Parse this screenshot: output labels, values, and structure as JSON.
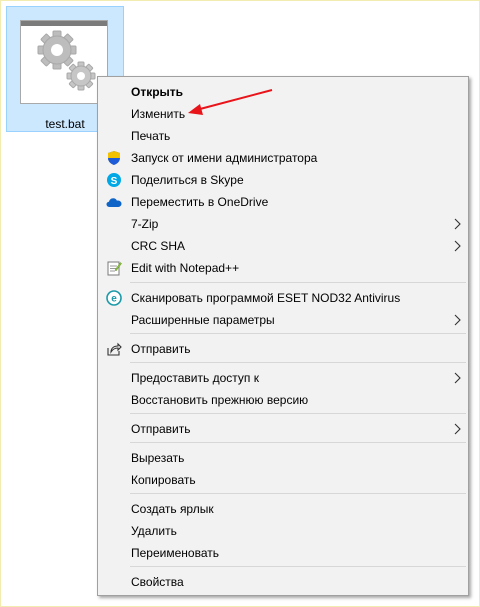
{
  "file": {
    "name": "test.bat",
    "icon": "batch-file-gear-icon"
  },
  "menu": {
    "items": [
      {
        "label": "Открыть",
        "bold": true
      },
      {
        "label": "Изменить"
      },
      {
        "label": "Печать"
      },
      {
        "label": "Запуск от имени администратора",
        "icon": "uac-shield-icon"
      },
      {
        "label": "Поделиться в Skype",
        "icon": "skype-icon"
      },
      {
        "label": "Переместить в OneDrive",
        "icon": "onedrive-icon"
      },
      {
        "label": "7-Zip",
        "submenu": true
      },
      {
        "label": "CRC SHA",
        "submenu": true
      },
      {
        "label": "Edit with Notepad++",
        "icon": "notepadpp-icon"
      },
      {
        "label": "Сканировать программой ESET NOD32 Antivirus",
        "icon": "eset-icon"
      },
      {
        "label": "Расширенные параметры",
        "submenu": true
      },
      {
        "label": "Отправить",
        "icon": "share-icon"
      },
      {
        "label": "Предоставить доступ к",
        "submenu": true
      },
      {
        "label": "Восстановить прежнюю версию"
      },
      {
        "label": "Отправить",
        "submenu": true
      },
      {
        "label": "Вырезать"
      },
      {
        "label": "Копировать"
      },
      {
        "label": "Создать ярлык"
      },
      {
        "label": "Удалить"
      },
      {
        "label": "Переименовать"
      },
      {
        "label": "Свойства"
      }
    ]
  },
  "colors": {
    "selection_bg": "#cce8ff",
    "menu_bg": "#f2f2f2",
    "annotation_arrow": "#e8141a"
  }
}
